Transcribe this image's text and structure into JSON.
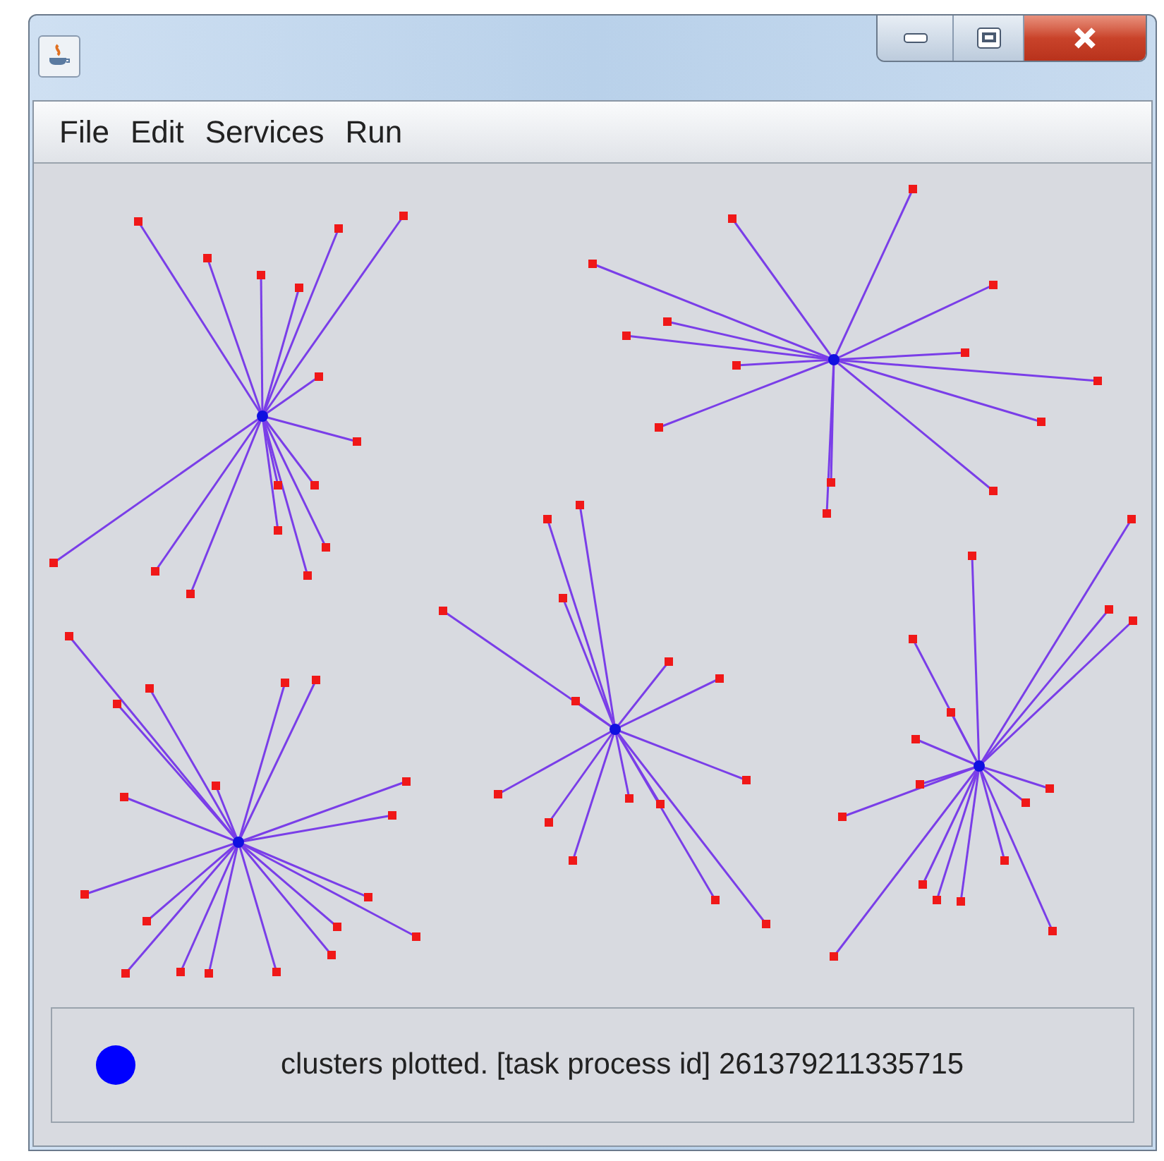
{
  "menu_bar": {
    "items": [
      {
        "label": "File"
      },
      {
        "label": "Edit"
      },
      {
        "label": "Services"
      },
      {
        "label": "Run"
      }
    ]
  },
  "status_bar": {
    "message": "clusters plotted. [task process id] 261379211335715"
  }
}
